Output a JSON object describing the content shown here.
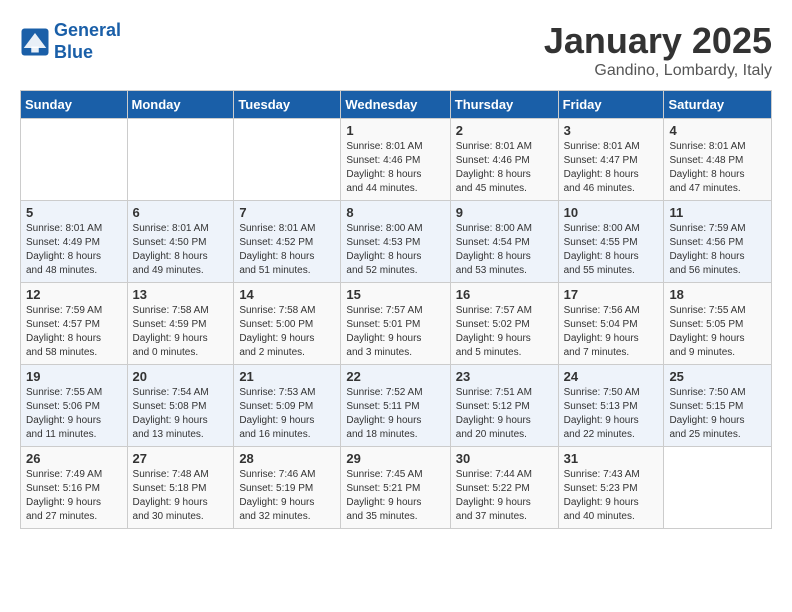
{
  "header": {
    "logo_line1": "General",
    "logo_line2": "Blue",
    "month_year": "January 2025",
    "location": "Gandino, Lombardy, Italy"
  },
  "weekdays": [
    "Sunday",
    "Monday",
    "Tuesday",
    "Wednesday",
    "Thursday",
    "Friday",
    "Saturday"
  ],
  "weeks": [
    [
      {
        "day": "",
        "info": ""
      },
      {
        "day": "",
        "info": ""
      },
      {
        "day": "",
        "info": ""
      },
      {
        "day": "1",
        "info": "Sunrise: 8:01 AM\nSunset: 4:46 PM\nDaylight: 8 hours\nand 44 minutes."
      },
      {
        "day": "2",
        "info": "Sunrise: 8:01 AM\nSunset: 4:46 PM\nDaylight: 8 hours\nand 45 minutes."
      },
      {
        "day": "3",
        "info": "Sunrise: 8:01 AM\nSunset: 4:47 PM\nDaylight: 8 hours\nand 46 minutes."
      },
      {
        "day": "4",
        "info": "Sunrise: 8:01 AM\nSunset: 4:48 PM\nDaylight: 8 hours\nand 47 minutes."
      }
    ],
    [
      {
        "day": "5",
        "info": "Sunrise: 8:01 AM\nSunset: 4:49 PM\nDaylight: 8 hours\nand 48 minutes."
      },
      {
        "day": "6",
        "info": "Sunrise: 8:01 AM\nSunset: 4:50 PM\nDaylight: 8 hours\nand 49 minutes."
      },
      {
        "day": "7",
        "info": "Sunrise: 8:01 AM\nSunset: 4:52 PM\nDaylight: 8 hours\nand 51 minutes."
      },
      {
        "day": "8",
        "info": "Sunrise: 8:00 AM\nSunset: 4:53 PM\nDaylight: 8 hours\nand 52 minutes."
      },
      {
        "day": "9",
        "info": "Sunrise: 8:00 AM\nSunset: 4:54 PM\nDaylight: 8 hours\nand 53 minutes."
      },
      {
        "day": "10",
        "info": "Sunrise: 8:00 AM\nSunset: 4:55 PM\nDaylight: 8 hours\nand 55 minutes."
      },
      {
        "day": "11",
        "info": "Sunrise: 7:59 AM\nSunset: 4:56 PM\nDaylight: 8 hours\nand 56 minutes."
      }
    ],
    [
      {
        "day": "12",
        "info": "Sunrise: 7:59 AM\nSunset: 4:57 PM\nDaylight: 8 hours\nand 58 minutes."
      },
      {
        "day": "13",
        "info": "Sunrise: 7:58 AM\nSunset: 4:59 PM\nDaylight: 9 hours\nand 0 minutes."
      },
      {
        "day": "14",
        "info": "Sunrise: 7:58 AM\nSunset: 5:00 PM\nDaylight: 9 hours\nand 2 minutes."
      },
      {
        "day": "15",
        "info": "Sunrise: 7:57 AM\nSunset: 5:01 PM\nDaylight: 9 hours\nand 3 minutes."
      },
      {
        "day": "16",
        "info": "Sunrise: 7:57 AM\nSunset: 5:02 PM\nDaylight: 9 hours\nand 5 minutes."
      },
      {
        "day": "17",
        "info": "Sunrise: 7:56 AM\nSunset: 5:04 PM\nDaylight: 9 hours\nand 7 minutes."
      },
      {
        "day": "18",
        "info": "Sunrise: 7:55 AM\nSunset: 5:05 PM\nDaylight: 9 hours\nand 9 minutes."
      }
    ],
    [
      {
        "day": "19",
        "info": "Sunrise: 7:55 AM\nSunset: 5:06 PM\nDaylight: 9 hours\nand 11 minutes."
      },
      {
        "day": "20",
        "info": "Sunrise: 7:54 AM\nSunset: 5:08 PM\nDaylight: 9 hours\nand 13 minutes."
      },
      {
        "day": "21",
        "info": "Sunrise: 7:53 AM\nSunset: 5:09 PM\nDaylight: 9 hours\nand 16 minutes."
      },
      {
        "day": "22",
        "info": "Sunrise: 7:52 AM\nSunset: 5:11 PM\nDaylight: 9 hours\nand 18 minutes."
      },
      {
        "day": "23",
        "info": "Sunrise: 7:51 AM\nSunset: 5:12 PM\nDaylight: 9 hours\nand 20 minutes."
      },
      {
        "day": "24",
        "info": "Sunrise: 7:50 AM\nSunset: 5:13 PM\nDaylight: 9 hours\nand 22 minutes."
      },
      {
        "day": "25",
        "info": "Sunrise: 7:50 AM\nSunset: 5:15 PM\nDaylight: 9 hours\nand 25 minutes."
      }
    ],
    [
      {
        "day": "26",
        "info": "Sunrise: 7:49 AM\nSunset: 5:16 PM\nDaylight: 9 hours\nand 27 minutes."
      },
      {
        "day": "27",
        "info": "Sunrise: 7:48 AM\nSunset: 5:18 PM\nDaylight: 9 hours\nand 30 minutes."
      },
      {
        "day": "28",
        "info": "Sunrise: 7:46 AM\nSunset: 5:19 PM\nDaylight: 9 hours\nand 32 minutes."
      },
      {
        "day": "29",
        "info": "Sunrise: 7:45 AM\nSunset: 5:21 PM\nDaylight: 9 hours\nand 35 minutes."
      },
      {
        "day": "30",
        "info": "Sunrise: 7:44 AM\nSunset: 5:22 PM\nDaylight: 9 hours\nand 37 minutes."
      },
      {
        "day": "31",
        "info": "Sunrise: 7:43 AM\nSunset: 5:23 PM\nDaylight: 9 hours\nand 40 minutes."
      },
      {
        "day": "",
        "info": ""
      }
    ]
  ]
}
